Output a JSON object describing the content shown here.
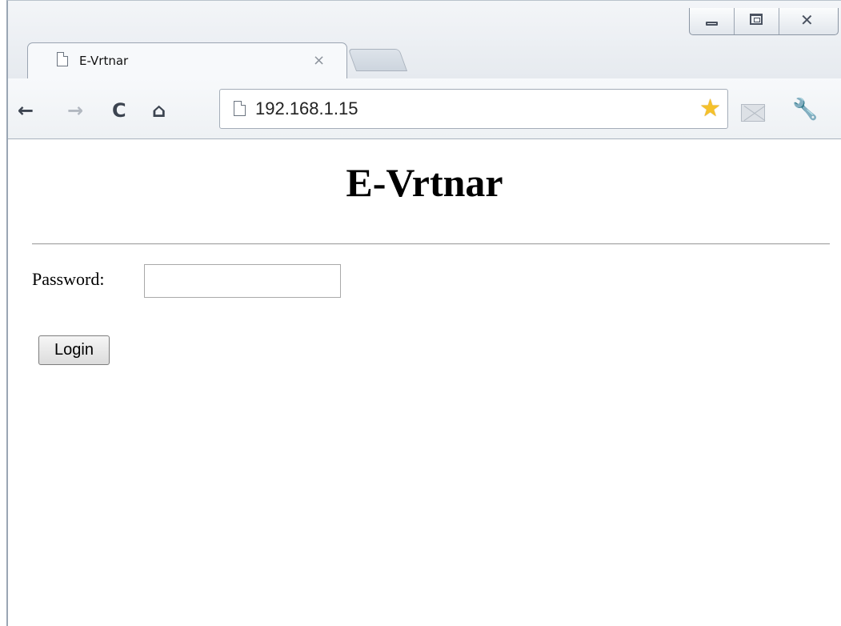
{
  "browser": {
    "tab": {
      "title": "E-Vrtnar",
      "close_glyph": "×",
      "icon": "page-icon"
    },
    "window_controls": {
      "minimize": "minimize-icon",
      "maximize": "maximize-icon",
      "close": "✕"
    },
    "toolbar": {
      "back": "←",
      "forward": "→",
      "reload": "C",
      "home": "⌂",
      "url": "192.168.1.15",
      "bookmark_star": "★",
      "wrench": "🔧"
    }
  },
  "page": {
    "heading": "E-Vrtnar",
    "password_label": "Password:",
    "password_value": "",
    "login_button": "Login"
  },
  "colors": {
    "star": "#f5c12b",
    "chrome_frame": "#e6eaef"
  }
}
